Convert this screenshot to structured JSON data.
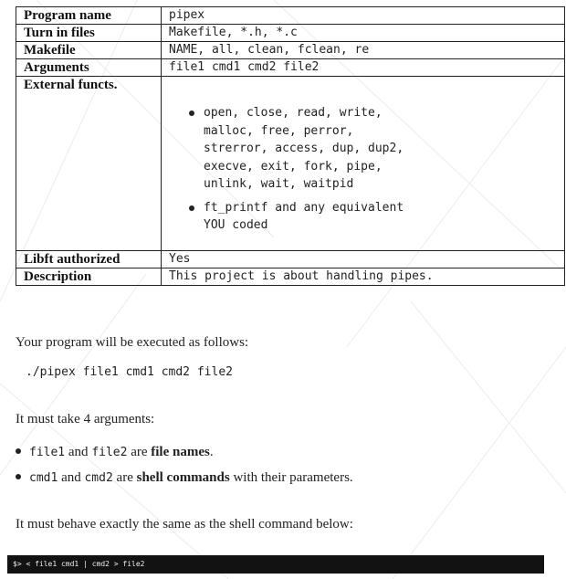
{
  "spec_table": {
    "rows": [
      {
        "key": "Program name",
        "value": "pipex"
      },
      {
        "key": "Turn in files",
        "value": "Makefile, *.h, *.c"
      },
      {
        "key": "Makefile",
        "value": "NAME, all, clean, fclean, re"
      },
      {
        "key": "Arguments",
        "value": "file1 cmd1 cmd2 file2"
      },
      {
        "key": "External functs.",
        "bullets": [
          "open, close, read, write,\nmalloc, free, perror,\nstrerror, access, dup, dup2,\nexecve, exit, fork, pipe,\nunlink, wait, waitpid",
          "ft_printf and any equivalent\nYOU coded"
        ]
      },
      {
        "key": "Libft authorized",
        "value": "Yes"
      },
      {
        "key": "Description",
        "value": "This project is about handling pipes."
      }
    ]
  },
  "body": {
    "intro": "Your program will be executed as follows:",
    "usage": "./pipex file1 cmd1 cmd2 file2",
    "args_intro": "It must take 4 arguments:",
    "bullet1": {
      "code_a": "file1",
      "text_a": " and ",
      "code_b": "file2",
      "text_b": " are ",
      "bold": "file names",
      "end": "."
    },
    "bullet2": {
      "code_a": "cmd1",
      "text_a": " and ",
      "code_b": "cmd2",
      "text_b": " are ",
      "bold": "shell commands",
      "end": " with their parameters."
    },
    "behave": "It must behave exactly the same as the shell command below:",
    "terminal": "$> < file1 cmd1 | cmd2 > file2"
  }
}
